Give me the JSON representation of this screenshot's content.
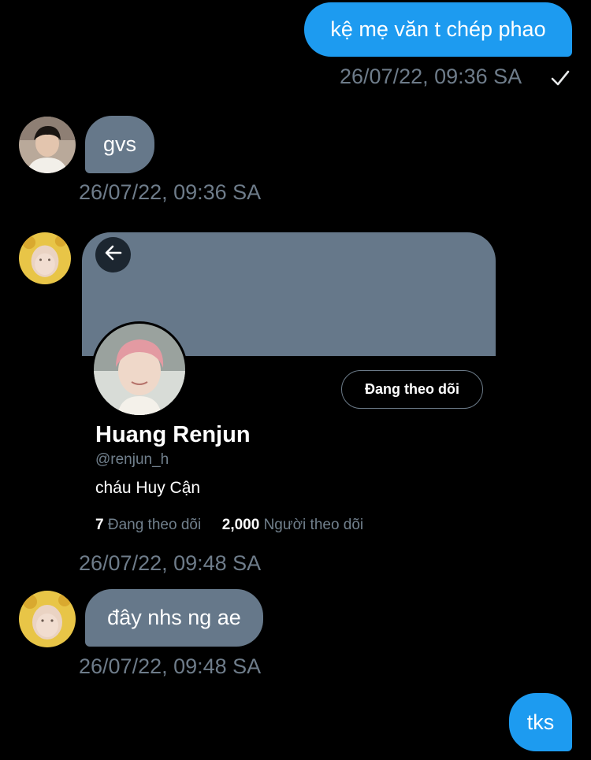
{
  "messages": {
    "m1": {
      "text": "kệ mẹ văn t chép phao",
      "timestamp": "26/07/22, 09:36 SA",
      "status_icon": "checkmark-icon"
    },
    "m2": {
      "text": "gvs",
      "timestamp": "26/07/22, 09:36 SA"
    },
    "m3": {
      "timestamp": "26/07/22, 09:48 SA"
    },
    "m4": {
      "text": "đây nhs ng ae",
      "timestamp": "26/07/22, 09:48 SA"
    },
    "m5": {
      "text": "tks"
    }
  },
  "profile_card": {
    "back_icon": "arrow-left-icon",
    "follow_button": "Đang theo dõi",
    "name": "Huang Renjun",
    "handle": "@renjun_h",
    "bio": "cháu Huy Cận",
    "following_count": "7",
    "following_label": "Đang theo dõi",
    "followers_count": "2,000",
    "followers_label": "Người theo dõi"
  },
  "colors": {
    "background": "#000000",
    "outgoing_bubble": "#1d9bf0",
    "incoming_bubble": "#66788a",
    "timestamp": "#6e7c8a"
  }
}
